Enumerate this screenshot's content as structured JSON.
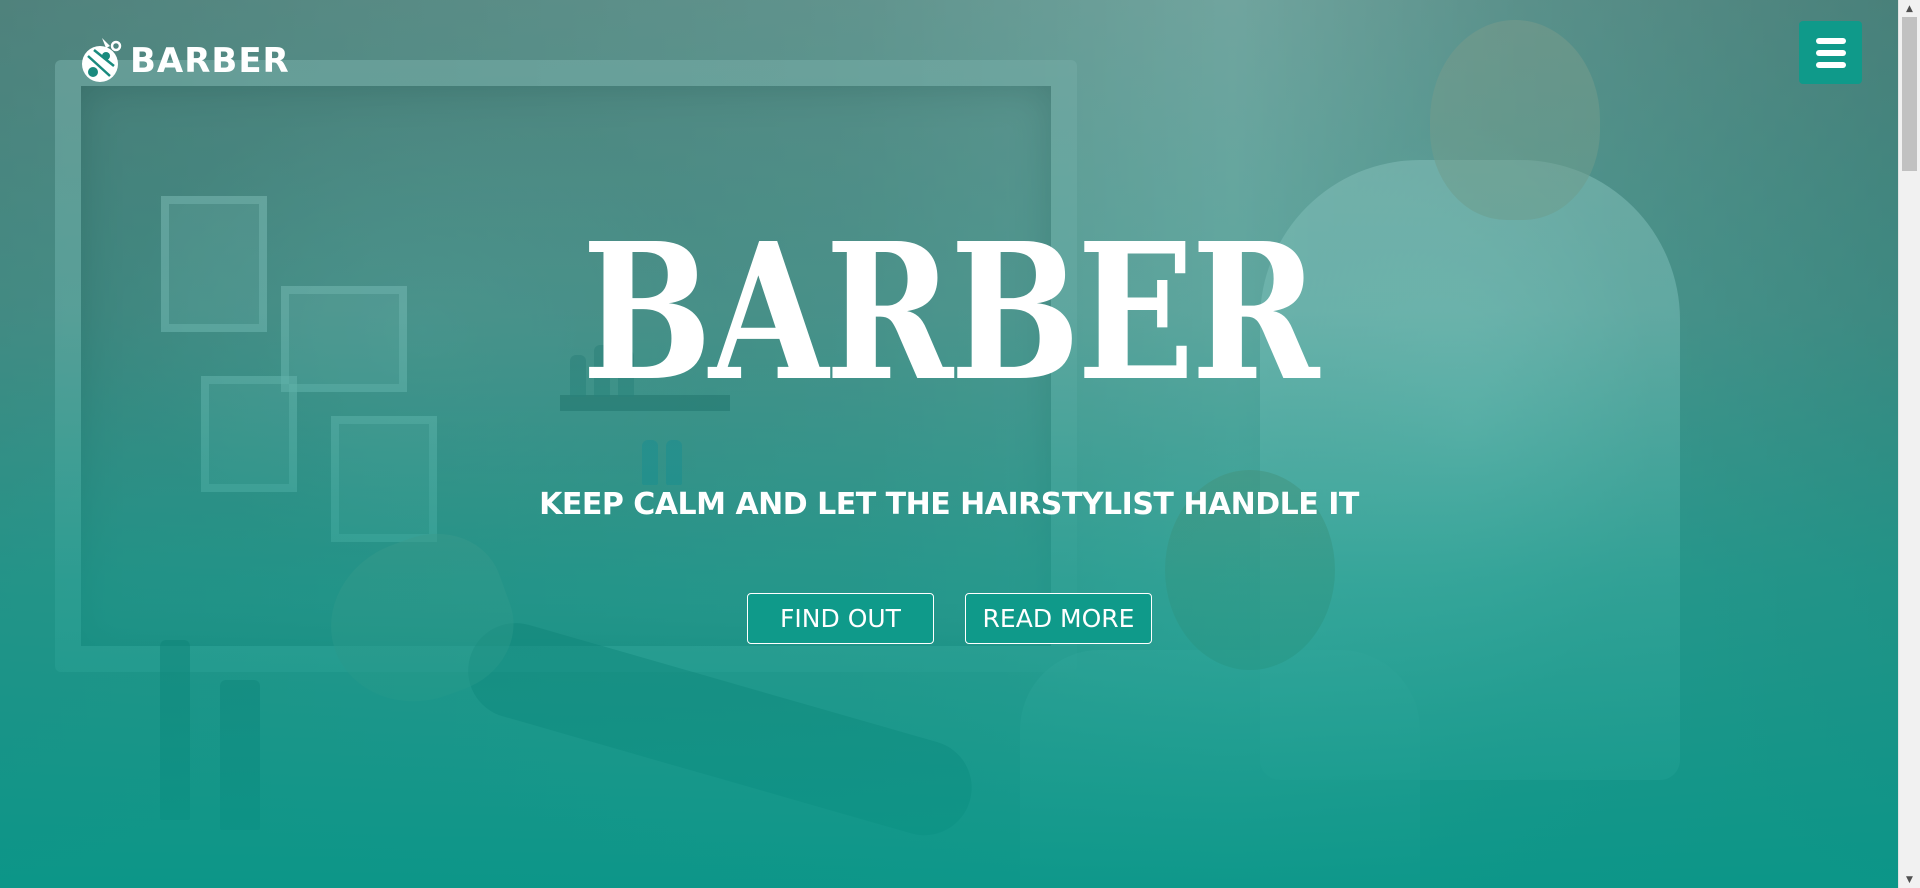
{
  "header": {
    "logo_text": "BARBER",
    "logo_icon": "barber-scissors-logo-icon",
    "menu_icon": "hamburger-menu-icon"
  },
  "hero": {
    "title": "BARBER",
    "tagline": "KEEP CALM AND LET THE HAIRSTYLIST HANDLE IT",
    "buttons": [
      {
        "label": "FIND OUT"
      },
      {
        "label": "READ MORE"
      }
    ]
  },
  "scrollbar": {
    "up_icon": "scroll-up-arrow-icon",
    "down_icon": "scroll-down-arrow-icon"
  },
  "colors": {
    "accent": "#0f9a8a",
    "overlay": "#0a9688",
    "text": "#ffffff"
  }
}
